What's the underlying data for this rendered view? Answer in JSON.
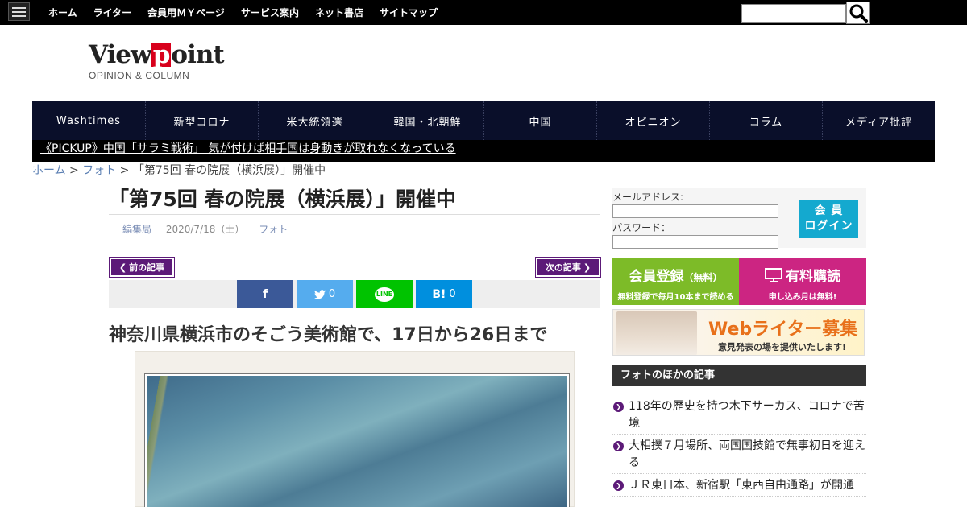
{
  "top_nav": [
    "ホーム",
    "ライター",
    "会員用ＭＹページ",
    "サービス案内",
    "ネット書店",
    "サイトマップ"
  ],
  "logo": {
    "pre": "View",
    "p": "p",
    "post": "oint",
    "sub": "OPINION & COLUMN"
  },
  "main_nav": [
    "Washtimes",
    "新型コロナ",
    "米大統領選",
    "韓国・北朝鮮",
    "中国",
    "オピニオン",
    "コラム",
    "メディア批評"
  ],
  "pickup": "《PICKUP》中国「サラミ戦術」 気が付けば相手国は身動きが取れなくなっている",
  "breadcrumb": {
    "home": "ホーム",
    "sep1": " > ",
    "cat": "フォト",
    "sep2": " >  ",
    "current": "「第75回 春の院展（横浜展）」開催中"
  },
  "article": {
    "title": "「第75回 春の院展（横浜展）」開催中",
    "author": "編集局",
    "date": "2020/7/18（土）",
    "category": "フォト",
    "prev_label": "前の記事",
    "next_label": "次の記事",
    "subtitle": "神奈川県横浜市のそごう美術館で、17日から26日まで"
  },
  "share": {
    "fb": "f",
    "tw_count": "0",
    "line": "LINE",
    "hb": "B!",
    "hb_count": "0"
  },
  "login": {
    "email_label": "メールアドレス:",
    "password_label": "パスワード：",
    "button_line1": "会 員",
    "button_line2": "ログイン"
  },
  "banners": {
    "reg_main": "会員登録",
    "reg_paren": "（無料）",
    "reg_sub": "無料登録で毎月10本まで読める",
    "paid_main": "有料購読",
    "paid_sub": "申し込み月は無料!",
    "writer_title": "Webライター募集",
    "writer_sub": "意見発表の場を提供いたします!"
  },
  "sidebar": {
    "heading": "フォトのほかの記事",
    "items": [
      "118年の歴史を持つ木下サーカス、コロナで苦境",
      "大相撲７月場所、両国国技館で無事初日を迎える",
      "ＪＲ東日本、新宿駅「東西自由通路」が開通"
    ]
  },
  "colors": {
    "nav_bg": "#0a0f2a",
    "accent_purple": "#5c1a78",
    "login_blue": "#14a9cf",
    "logo_red": "#d8001c"
  }
}
